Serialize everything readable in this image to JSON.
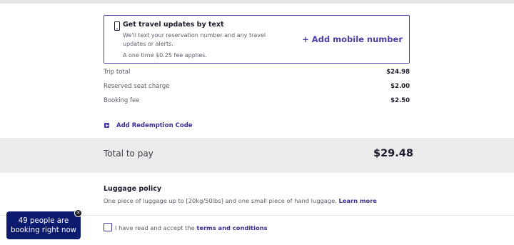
{
  "sms_updates": {
    "title": "Get travel updates by text",
    "description": "We'll text your reservation number and any travel updates or alerts.",
    "fee_note": "A one time $0.25 fee applies.",
    "add_mobile_label": "+ Add mobile number",
    "icon": "mobile-phone-icon"
  },
  "fees": [
    {
      "label": "Trip total",
      "amount": "$24.98"
    },
    {
      "label": "Reserved seat charge",
      "amount": "$2.00"
    },
    {
      "label": "Booking fee",
      "amount": "$2.50"
    }
  ],
  "redemption": {
    "label": "Add Redemption Code",
    "icon": "plus-square-icon"
  },
  "total": {
    "label": "Total to pay",
    "amount": "$29.48"
  },
  "luggage": {
    "title": "Luggage policy",
    "text": "One piece of luggage up to [20kg/50lbs] and one small piece of hand luggage.",
    "link_label": "Learn more"
  },
  "terms": {
    "text": "I have read and accept the",
    "link_label": "terms and conditions",
    "checked": false
  },
  "toast": {
    "line1": "49 people are",
    "line2": "booking right now",
    "close_icon": "close-icon"
  },
  "colors": {
    "accent": "#4b3fa8",
    "link": "#3a3192",
    "toast_bg": "#0c1b6e",
    "total_band": "#ececec"
  }
}
